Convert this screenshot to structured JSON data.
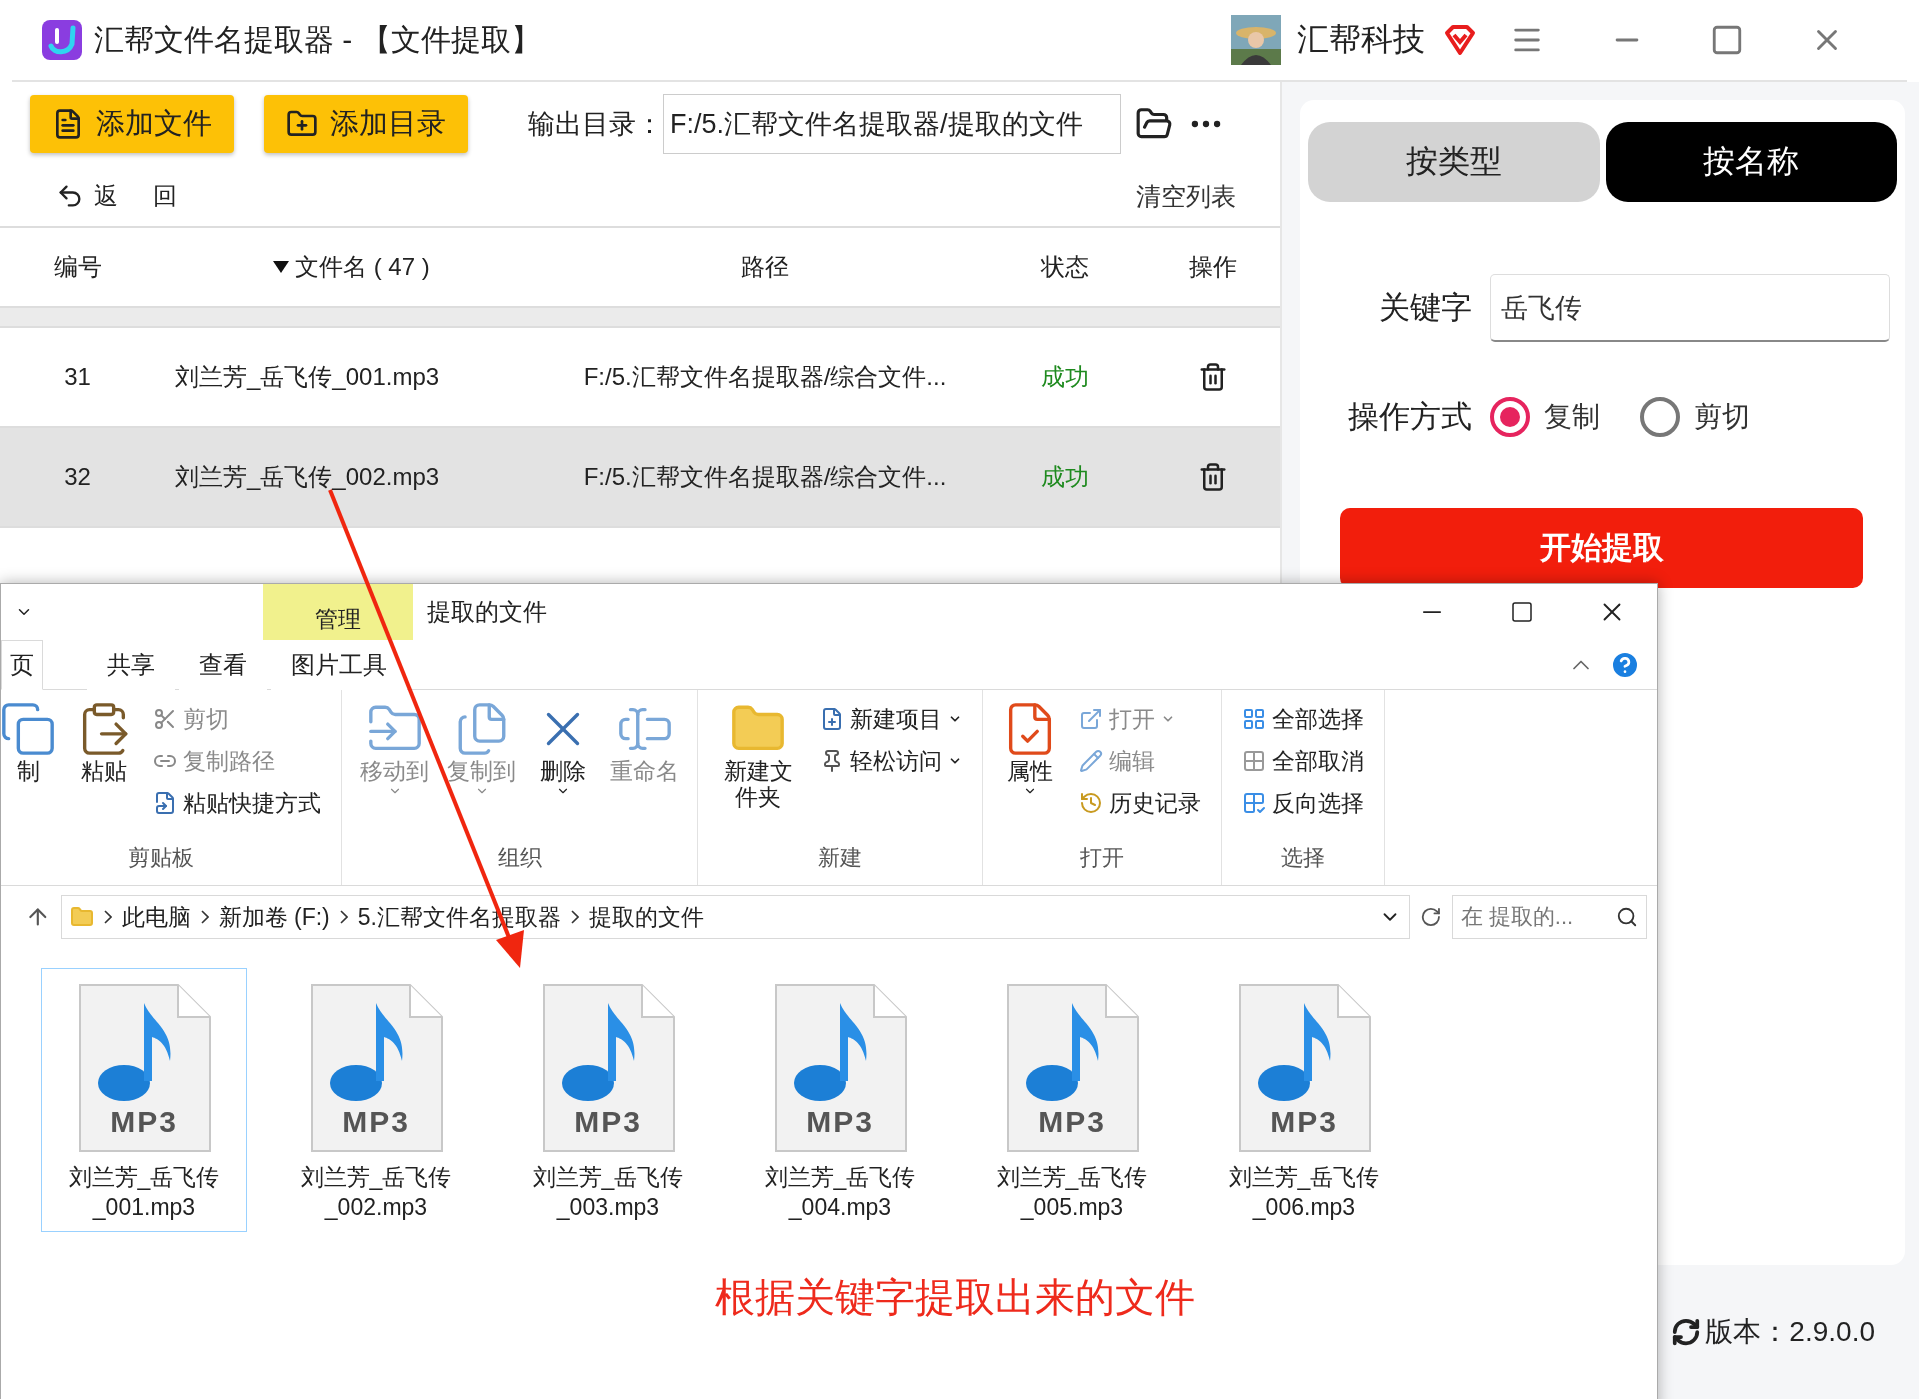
{
  "app": {
    "title": "汇帮文件名提取器 - 【文件提取】",
    "brand": "汇帮科技"
  },
  "toolbar": {
    "buttons": [
      "添加文件",
      "添加目录"
    ],
    "output_label": "输出目录：",
    "output_path": "F:/5.汇帮文件名提取器/提取的文件"
  },
  "back": "返 回",
  "clear": "清空列表",
  "table": {
    "columns": [
      {
        "label": "编号",
        "sorted": false
      },
      {
        "label": "文件名 ( 47 )",
        "sorted": true
      },
      {
        "label": "路径",
        "sorted": false
      },
      {
        "label": "状态",
        "sorted": false
      },
      {
        "label": "操作",
        "sorted": false
      }
    ],
    "rows": [
      {
        "number": "31",
        "name": "刘兰芳_岳飞传_001.mp3",
        "path": "F:/5.汇帮文件名提取器/综合文件...",
        "status": "成功",
        "selected": false
      },
      {
        "number": "32",
        "name": "刘兰芳_岳飞传_002.mp3",
        "path": "F:/5.汇帮文件名提取器/综合文件...",
        "status": "成功",
        "selected": true
      }
    ]
  },
  "mode_tabs": [
    {
      "label": "按类型",
      "selected": false
    },
    {
      "label": "按名称",
      "selected": true
    }
  ],
  "keyword": {
    "label": "关键字",
    "value": "岳飞传"
  },
  "operation": {
    "label": "操作方式",
    "options": [
      {
        "label": "复制",
        "selected": true
      },
      {
        "label": "剪切",
        "selected": false
      }
    ]
  },
  "start_button": "开始提取",
  "version": "版本：2.9.0.0",
  "explorer": {
    "context_tab": "管理",
    "title": "提取的文件",
    "tabs": [
      {
        "label": "页",
        "selected": true
      },
      {
        "label": "共享",
        "selected": false
      },
      {
        "label": "查看",
        "selected": false
      },
      {
        "label": "图片工具",
        "selected": false
      }
    ],
    "groups": [
      {
        "label": "剪贴板",
        "large": [
          {
            "label": "制",
            "disabled": false,
            "menu": false
          },
          {
            "label": "粘贴",
            "disabled": false,
            "menu": false
          }
        ],
        "small": [
          {
            "label": "剪切",
            "disabled": true,
            "menu": false
          },
          {
            "label": "复制路径",
            "disabled": true,
            "menu": false
          },
          {
            "label": "粘贴快捷方式",
            "disabled": false,
            "menu": false
          }
        ]
      },
      {
        "label": "组织",
        "large": [
          {
            "label": "移动到",
            "disabled": true,
            "menu": true
          },
          {
            "label": "复制到",
            "disabled": true,
            "menu": true
          },
          {
            "label": "删除",
            "disabled": false,
            "menu": true
          },
          {
            "label": "重命名",
            "disabled": true,
            "menu": false
          }
        ]
      },
      {
        "label": "新建",
        "large": [
          {
            "label": "新建文件夹",
            "disabled": false,
            "menu": false
          }
        ],
        "small": [
          {
            "label": "新建项目",
            "disabled": false,
            "menu": true
          },
          {
            "label": "轻松访问",
            "disabled": false,
            "menu": true
          }
        ]
      },
      {
        "label": "打开",
        "large": [
          {
            "label": "属性",
            "disabled": false,
            "menu": true
          }
        ],
        "small": [
          {
            "label": "打开",
            "disabled": true,
            "menu": true
          },
          {
            "label": "编辑",
            "disabled": true,
            "menu": false
          },
          {
            "label": "历史记录",
            "disabled": false,
            "menu": false
          }
        ]
      },
      {
        "label": "选择",
        "small": [
          {
            "label": "全部选择",
            "disabled": false,
            "menu": false
          },
          {
            "label": "全部取消",
            "disabled": false,
            "menu": false
          },
          {
            "label": "反向选择",
            "disabled": false,
            "menu": false
          }
        ]
      }
    ],
    "breadcrumb": [
      "此电脑",
      "新加卷 (F:)",
      "5.汇帮文件名提取器",
      "提取的文件"
    ],
    "search": {
      "placeholder": "在 提取的..."
    },
    "files": [
      {
        "lines": [
          "刘兰芳_岳飞传",
          "_001.mp3"
        ],
        "type_label": "MP3",
        "selected": true
      },
      {
        "lines": [
          "刘兰芳_岳飞传",
          "_002.mp3"
        ],
        "type_label": "MP3",
        "selected": false
      },
      {
        "lines": [
          "刘兰芳_岳飞传",
          "_003.mp3"
        ],
        "type_label": "MP3",
        "selected": false
      },
      {
        "lines": [
          "刘兰芳_岳飞传",
          "_004.mp3"
        ],
        "type_label": "MP3",
        "selected": false
      },
      {
        "lines": [
          "刘兰芳_岳飞传",
          "_005.mp3"
        ],
        "type_label": "MP3",
        "selected": false
      },
      {
        "lines": [
          "刘兰芳_岳飞传",
          "_006.mp3"
        ],
        "type_label": "MP3",
        "selected": false
      }
    ]
  },
  "annotation": "根据关键字提取出来的文件"
}
